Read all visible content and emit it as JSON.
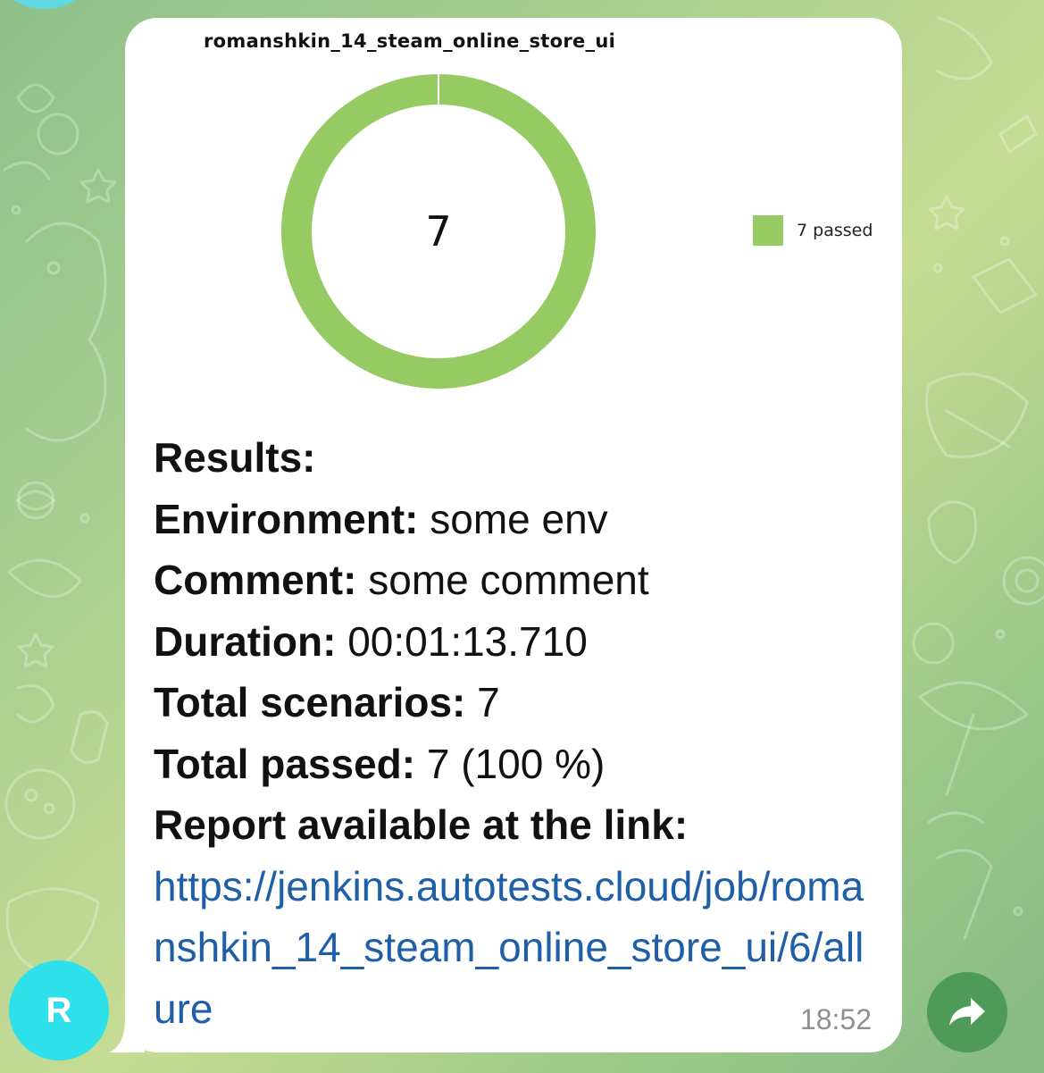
{
  "message": {
    "chart_title": "romanshkin_14_steam_online_store_ui",
    "chart_data": {
      "type": "pie",
      "categories": [
        "passed"
      ],
      "values": [
        7
      ],
      "center_label": "7",
      "legend": [
        "7 passed"
      ],
      "legend_position": "right",
      "colors": [
        "#96cb63"
      ]
    },
    "results_heading": "Results:",
    "environment_label": "Environment:",
    "environment_value": "some env",
    "comment_label": "Comment:",
    "comment_value": "some comment",
    "duration_label": "Duration:",
    "duration_value": "00:01:13.710",
    "scenarios_label": "Total scenarios:",
    "scenarios_value": "7",
    "passed_label": "Total passed:",
    "passed_value": "7 (100 %)",
    "report_label": "Report available at the link:",
    "report_link": "https://jenkins.autotests.cloud/job/romanshkin_14_steam_online_store_ui/6/allure",
    "time": "18:52"
  },
  "sender": {
    "avatar_initial": "R",
    "avatar_color": "#2ee0ea"
  },
  "icons": {
    "forward": "forward-arrow-icon"
  },
  "colors": {
    "link": "#1f5fa8",
    "chart_green": "#96cb63",
    "forward_button": "#4e9b57"
  }
}
